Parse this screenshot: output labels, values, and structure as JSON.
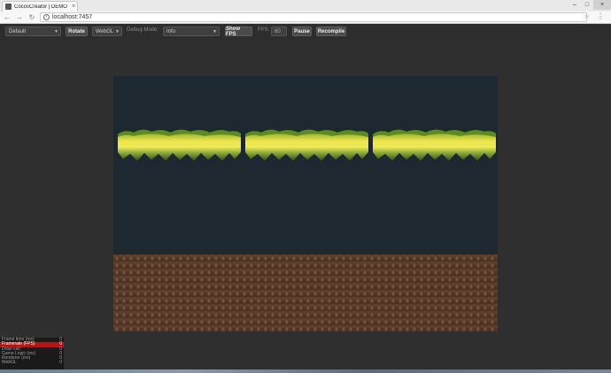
{
  "browser": {
    "tab_title": "CocosCreator | DEMO",
    "tab_close": "×",
    "url": "localhost:7457",
    "nav": {
      "back": "←",
      "forward": "→",
      "reload": "↻"
    },
    "info_glyph": "i",
    "star_glyph": "☆",
    "menu_glyph": "⋮",
    "window": {
      "minimize": "–",
      "maximize": "□",
      "close": "×"
    }
  },
  "toolbar": {
    "device_select": "Default",
    "rotate_label": "Rotate",
    "renderer_select": "WebGL",
    "debug_mode_label": "Debug Mode:",
    "debug_mode_select": "Info",
    "show_fps_label": "Show FPS",
    "fps_label": "FPS:",
    "fps_value": "60",
    "pause_label": "Pause",
    "recompile_label": "Recompile",
    "caret": "▼"
  },
  "stats": [
    {
      "label": "Frame time (ms)",
      "value": "0",
      "highlight": false
    },
    {
      "label": "Framerate (FPS)",
      "value": "0",
      "highlight": true
    },
    {
      "label": "Draw call",
      "value": "0",
      "highlight": false
    },
    {
      "label": "Game Logic (ms)",
      "value": "0",
      "highlight": false
    },
    {
      "label": "Renderer (ms)",
      "value": "0",
      "highlight": false
    },
    {
      "label": "WebGL",
      "value": "0",
      "highlight": false
    }
  ],
  "colors": {
    "canvas_bg": "#1e2831",
    "grass_light": "#e8e24a",
    "grass_dark": "#4f7a22",
    "dirt": "#4e3424",
    "stat_highlight": "#b01818"
  }
}
